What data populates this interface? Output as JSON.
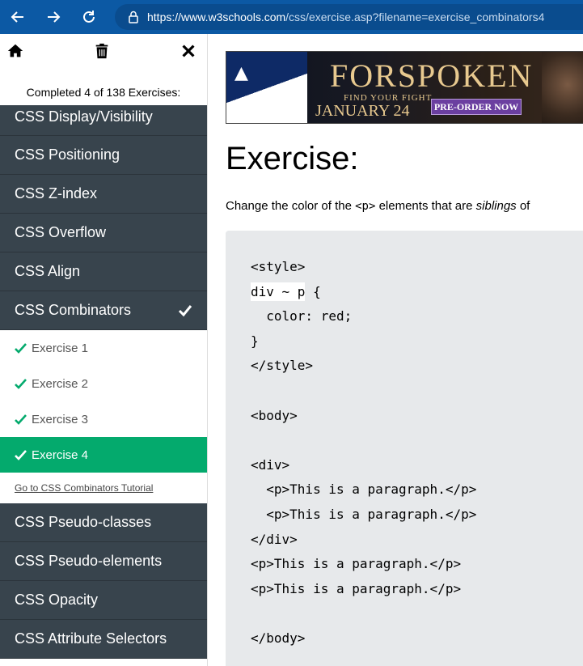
{
  "browser": {
    "url_host": "https://www.w3schools.com",
    "url_path": "/css/exercise.asp?filename=exercise_combinators4",
    "icons": [
      "back-icon",
      "forward-icon",
      "refresh-icon",
      "lock-icon"
    ]
  },
  "sidebar": {
    "tools": [
      "home-icon",
      "trash-icon",
      "close-icon"
    ],
    "status": "Completed 4 of 138 Exercises:",
    "items_before": [
      "CSS Display/Visibility",
      "CSS Positioning",
      "CSS Z-index",
      "CSS Overflow",
      "CSS Align"
    ],
    "active_section": "CSS Combinators",
    "exercises": [
      "Exercise 1",
      "Exercise 2",
      "Exercise 3",
      "Exercise 4"
    ],
    "active_exercise": "Exercise 4",
    "tutorial_link": "Go to CSS Combinators Tutorial",
    "items_after": [
      "CSS Pseudo-classes",
      "CSS Pseudo-elements",
      "CSS Opacity",
      "CSS Attribute Selectors"
    ]
  },
  "ad": {
    "title": "FORSPOKEN",
    "tagline": "FIND YOUR FIGHT",
    "date": "JANUARY 24",
    "cta": "PRE-ORDER NOW"
  },
  "main": {
    "title": "Exercise:",
    "desc_before": "Change the color of the ",
    "desc_code": "<p>",
    "desc_middle": " elements that are ",
    "desc_em": "siblings",
    "desc_after": " of",
    "code_lines": [
      "<style>",
      "{ANSWER} {",
      "  color: red;",
      "}",
      "</style>",
      "",
      "<body>",
      "",
      "<div>",
      "  <p>This is a paragraph.</p>",
      "  <p>This is a paragraph.</p>",
      "</div>",
      "<p>This is a paragraph.</p>",
      "<p>This is a paragraph.</p>",
      "",
      "</body>"
    ],
    "answer_value": "div ~ p"
  },
  "colors": {
    "browser_bar": "#0c59a4",
    "sidebar_dark": "#38444d",
    "active_green": "#04aa6d",
    "check_green": "#04aa6d",
    "code_bg": "#e7e9eb"
  }
}
